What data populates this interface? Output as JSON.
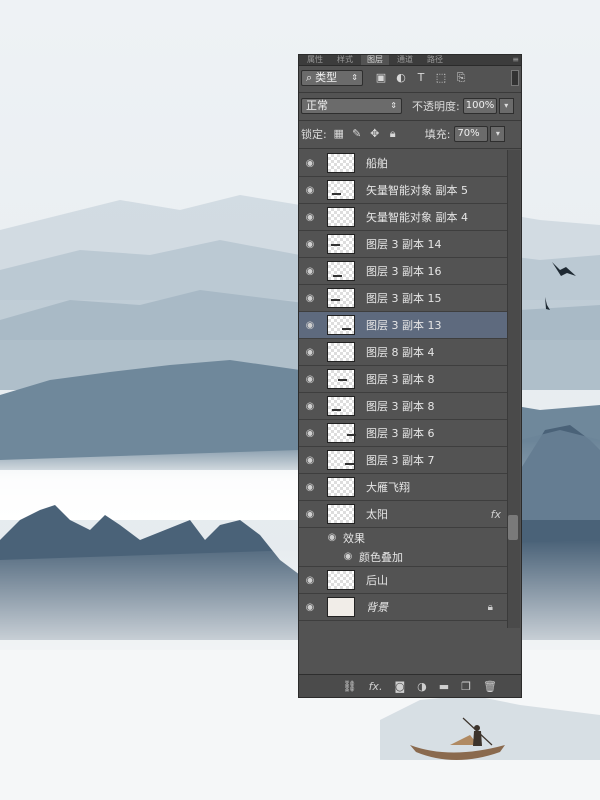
{
  "panel": {
    "tabs": [
      "属性",
      "样式",
      "图层",
      "通道",
      "路径"
    ],
    "active_tab": "图层",
    "filter_label": "类型",
    "blend_mode": "正常",
    "opacity_label": "不透明度:",
    "opacity_value": "100%",
    "lock_label": "锁定:",
    "fill_label": "填充:",
    "fill_value": "70%"
  },
  "layers": [
    {
      "name": "船舶",
      "mark": false
    },
    {
      "name": "矢量智能对象 副本 5",
      "mark": true
    },
    {
      "name": "矢量智能对象 副本 4",
      "mark": false
    },
    {
      "name": "图层 3 副本 14",
      "mark": true
    },
    {
      "name": "图层 3 副本 16",
      "mark": true
    },
    {
      "name": "图层 3 副本 15",
      "mark": true
    },
    {
      "name": "图层 3 副本 13",
      "mark": true,
      "selected": true
    },
    {
      "name": "图层 8 副本 4",
      "mark": false
    },
    {
      "name": "图层 3 副本 8",
      "mark": true
    },
    {
      "name": "图层 3 副本 8",
      "mark": true
    },
    {
      "name": "图层 3 副本 6",
      "mark": true
    },
    {
      "name": "图层 3 副本 7",
      "mark": true
    },
    {
      "name": "大雁飞翔",
      "mark": false
    },
    {
      "name": "太阳",
      "mark": false,
      "fx": "fx"
    },
    {
      "name": "后山",
      "mark": false
    },
    {
      "name": "背景",
      "mark": false,
      "italic": true,
      "plain": true,
      "lock": true
    }
  ],
  "effects": {
    "label": "效果",
    "item": "颜色叠加"
  },
  "colors": {
    "panel": "#535353",
    "selected": "#5e6a7e",
    "mountain_dark": "#4a6278",
    "mountain_light": "#b5c4cf"
  },
  "icons": {
    "eye": "eye-icon",
    "lock": "lock-icon",
    "link": "link-layers-icon",
    "new_layer": "new-layer-icon",
    "trash": "trash-icon"
  }
}
